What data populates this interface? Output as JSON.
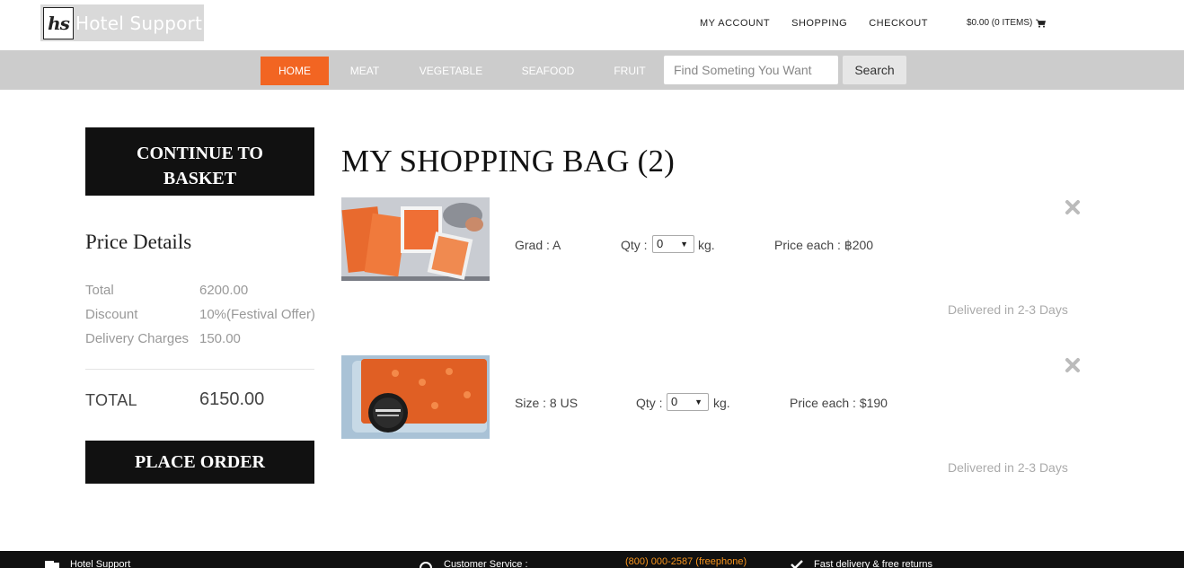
{
  "header": {
    "logo_mark": "hs",
    "logo_text": "Hotel Support",
    "links": [
      "MY ACCOUNT",
      "SHOPPING",
      "CHECKOUT"
    ],
    "cart": "$0.00 (0 ITEMS)"
  },
  "nav": {
    "items": [
      "HOME",
      "MEAT",
      "VEGETABLE",
      "SEAFOOD",
      "FRUIT"
    ],
    "search_placeholder": "Find Someting You Want",
    "search_button": "Search"
  },
  "sidebar": {
    "continue_line1": "CONTINUE TO",
    "continue_line2": "BASKET",
    "price_title": "Price Details",
    "rows": [
      {
        "label": "Total",
        "value": "6200.00"
      },
      {
        "label": "Discount",
        "value": "10%(Festival Offer)"
      },
      {
        "label": "Delivery Charges",
        "value": "150.00"
      }
    ],
    "total_label": "TOTAL",
    "total_value": "6150.00",
    "place_order": "PLACE ORDER"
  },
  "bag": {
    "title": "MY SHOPPING BAG (2)",
    "items": [
      {
        "attr": "Grad : A",
        "qty_label": "Qty :",
        "qty_value": "0",
        "unit": "kg.",
        "price": "Price each : ฿200",
        "delivery": "Delivered in 2-3 Days"
      },
      {
        "attr": "Size : 8 US",
        "qty_label": "Qty :",
        "qty_value": "0",
        "unit": "kg.",
        "price": "Price each : $190",
        "delivery": "Delivered in 2-3 Days"
      }
    ]
  },
  "footer": {
    "brand": "Hotel Support",
    "service": "Customer Service :",
    "phone": "(800) 000-2587 (freephone)",
    "delivery": "Fast delivery & free returns"
  },
  "colors": {
    "accent": "#f26522",
    "nav_bg": "#cccccc",
    "dark": "#111111",
    "phone": "#f7941d"
  }
}
